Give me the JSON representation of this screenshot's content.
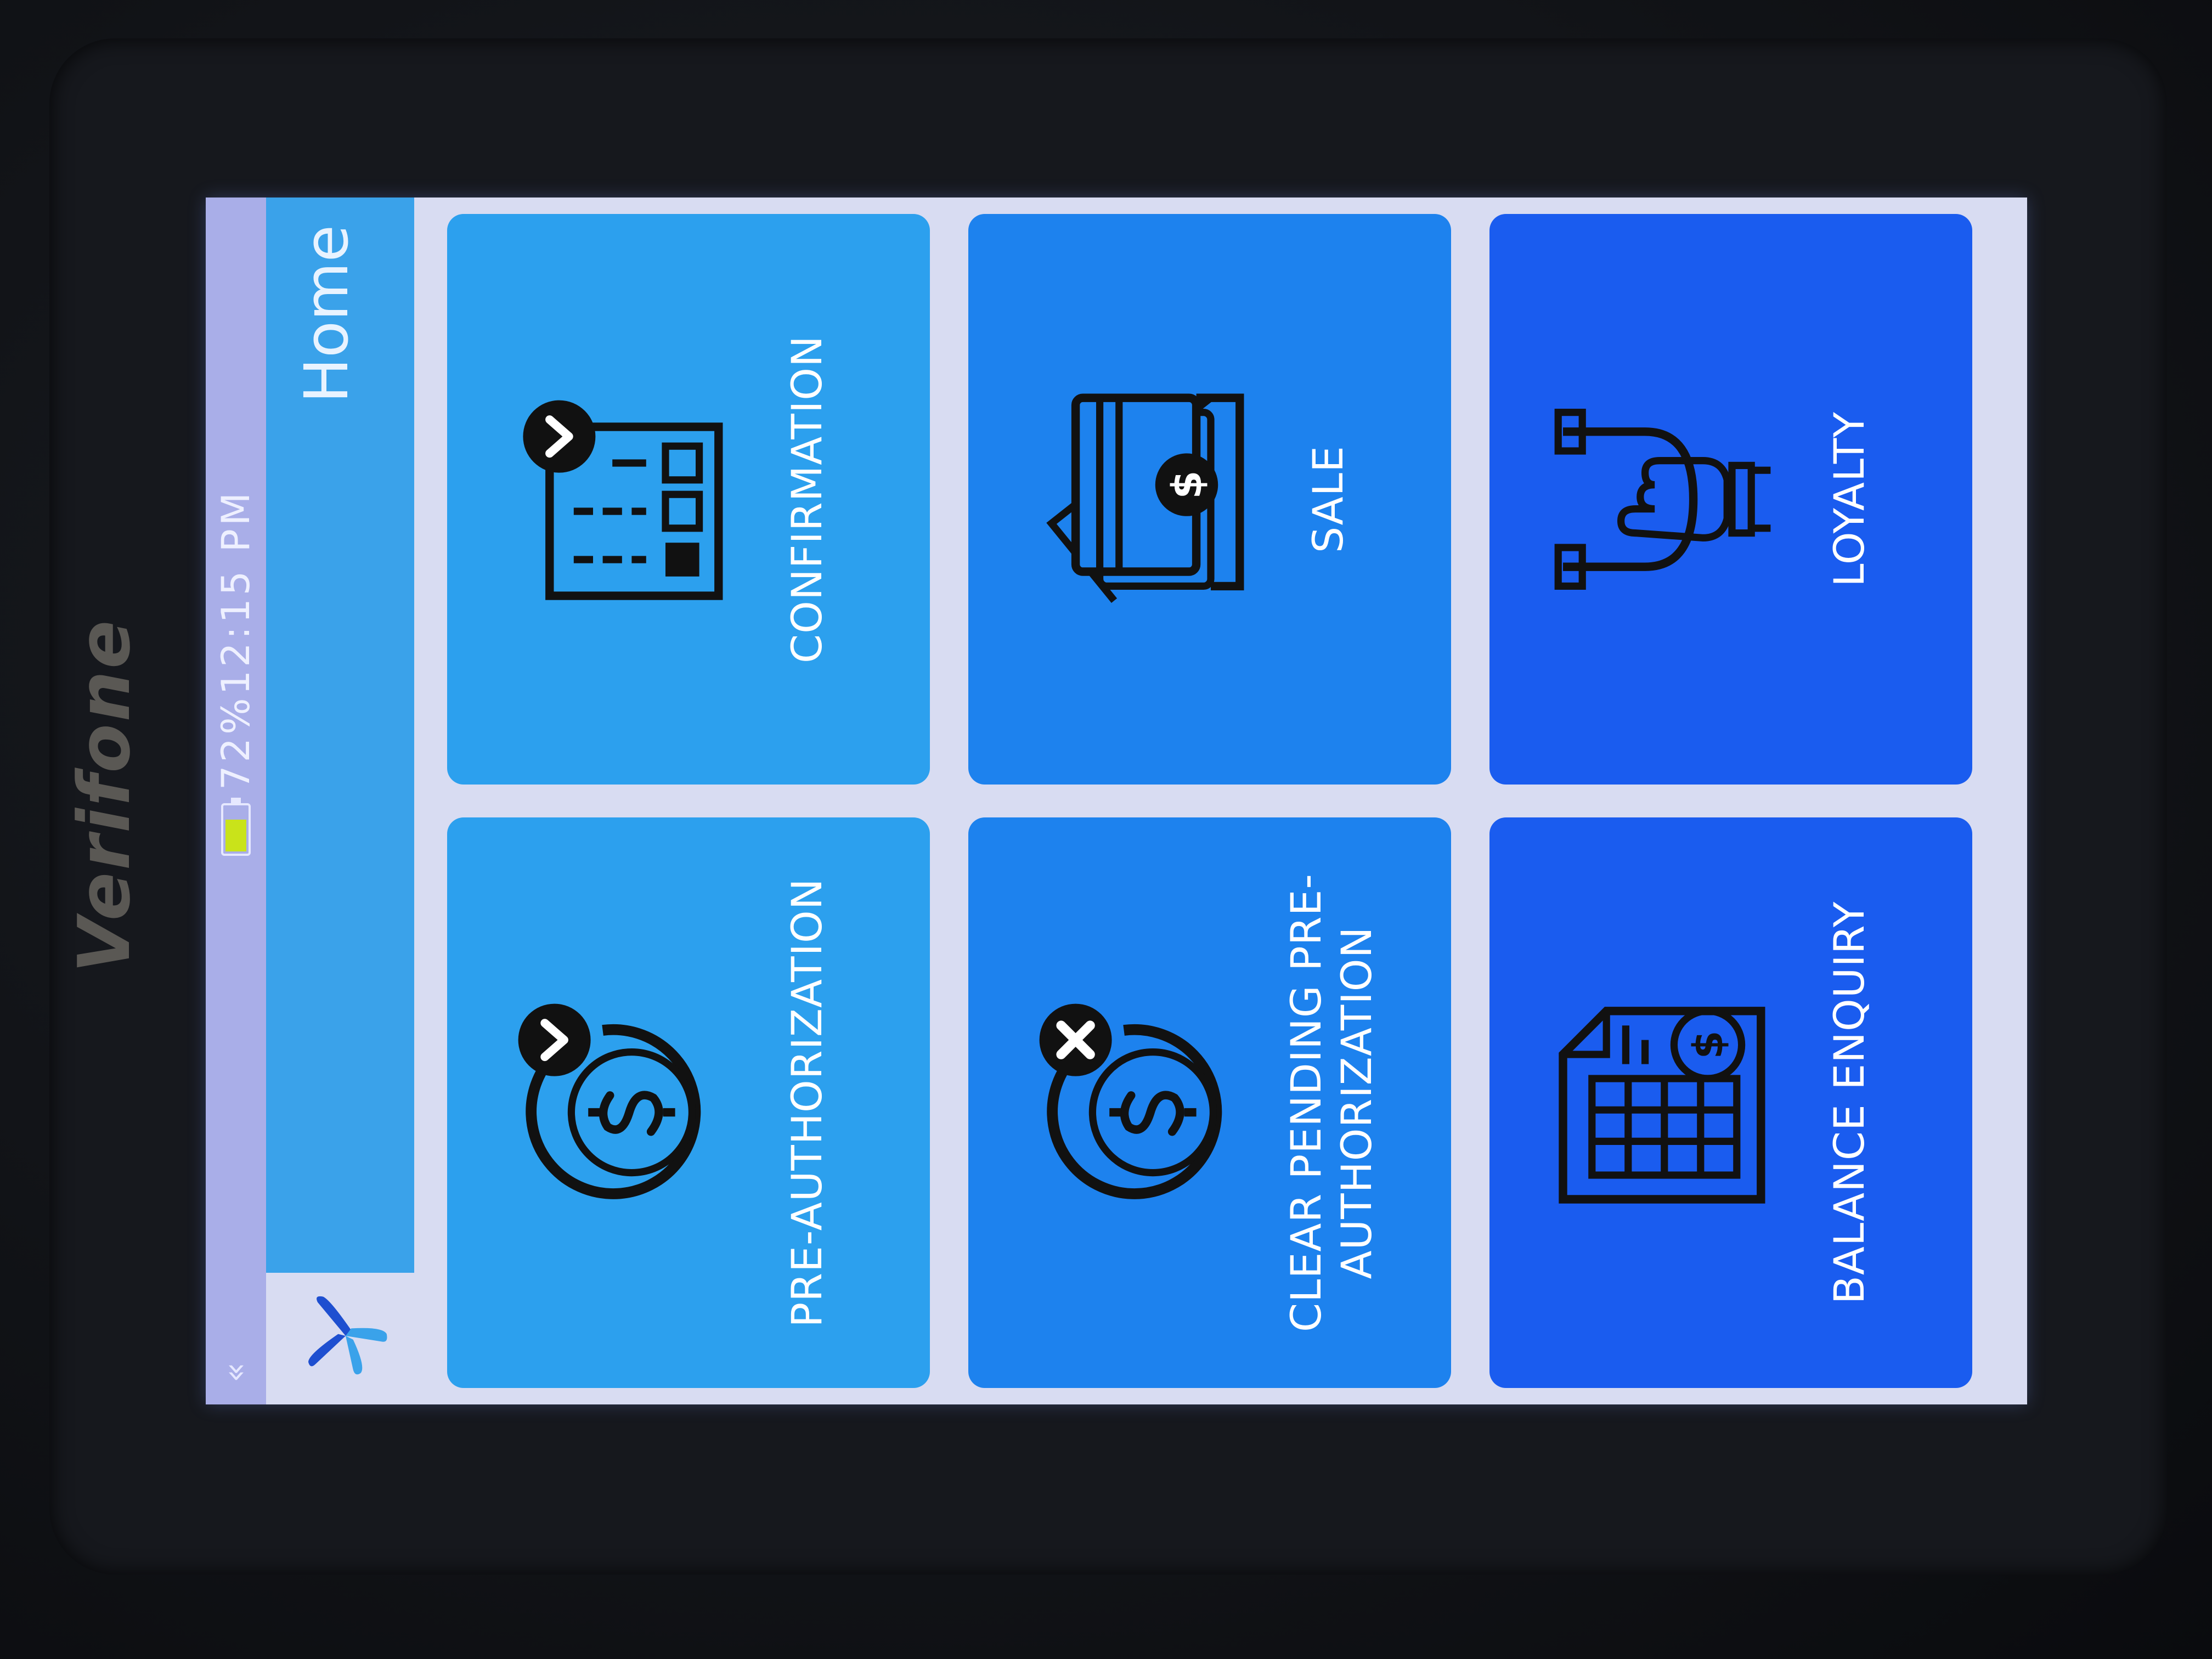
{
  "device": {
    "brand": "Verifone"
  },
  "status_bar": {
    "back_glyph": "«",
    "battery_percent": 72,
    "battery_text": "72%",
    "time": "12:15 PM",
    "battery_color": "#c9e31a"
  },
  "header": {
    "title": "Home",
    "accent": "#3aa2ea"
  },
  "tiles": [
    {
      "label": "PRE-AUTHORIZATION",
      "icon": "dollar-check-icon"
    },
    {
      "label": "CONFIRMATION",
      "icon": "checklist-check-icon"
    },
    {
      "label": "CLEAR PENDING PRE-AUTHORIZATION",
      "icon": "dollar-cancel-icon"
    },
    {
      "label": "SALE",
      "icon": "cards-dollar-icon"
    },
    {
      "label": "BALANCE ENQUIRY",
      "icon": "balance-document-icon"
    },
    {
      "label": "LOYALTY",
      "icon": "magnet-hand-icon"
    }
  ],
  "colors": {
    "tile_light": "#2ca0ee",
    "tile_mid": "#1d82ee",
    "tile_deep": "#1a5cef",
    "icon_stroke": "#101010"
  }
}
